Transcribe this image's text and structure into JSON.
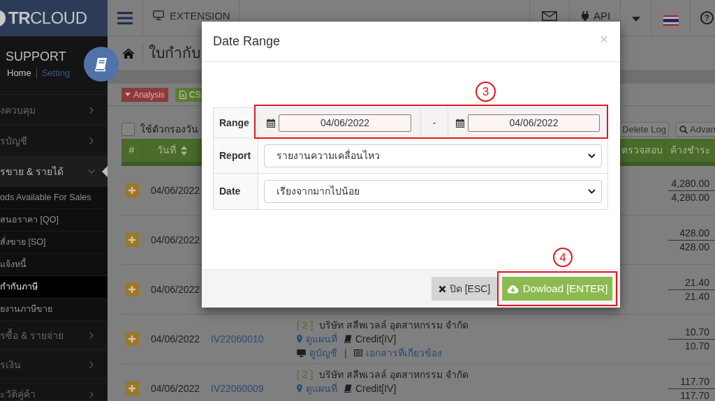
{
  "sidebar": {
    "logo": "**TR**CLOUD",
    "profile": {
      "name": "SUPPORT",
      "links": [
        {
          "kind": "current",
          "label": "Home"
        },
        {
          "kind": "link",
          "label": "Setting"
        }
      ]
    },
    "menu": [
      {
        "label": "งควบคุม",
        "expanded": false
      },
      {
        "label": "รบัญชี",
        "expanded": false
      },
      {
        "label": "รขาย & รายได้",
        "expanded": true,
        "children": [
          {
            "label": "ods Available For Sales",
            "selected": false
          },
          {
            "label": "สนอราคา [QO]",
            "selected": false
          },
          {
            "label": "สั่งขาย [SO]",
            "selected": false
          },
          {
            "label": "แจ้งหนี้",
            "selected": false
          },
          {
            "label": "กำกับภาษี",
            "selected": true
          },
          {
            "label": "ยงานภาษีขาย",
            "selected": false
          }
        ]
      },
      {
        "label": "รซื้อ & รายจ่าย",
        "expanded": false
      },
      {
        "label": "รเงิน",
        "expanded": false
      },
      {
        "label": "ะวัติคู่ค้า",
        "expanded": false
      }
    ]
  },
  "topbar": {
    "extension": "EXTENSION",
    "api": "API",
    "help": "?"
  },
  "page": {
    "title": "ใบกำกับ",
    "toolbar": [
      {
        "kind": "analysis",
        "label": "Analysis"
      },
      {
        "kind": "csv",
        "label": "CS"
      }
    ],
    "date_filter": {
      "label": "ใช้ตัวกรองวัน",
      "checked": false
    },
    "actions": [
      {
        "kind": "delete",
        "label": "Delete Log"
      },
      {
        "kind": "search",
        "label": "Advan"
      }
    ]
  },
  "table": {
    "columns": [
      {
        "kind": "index",
        "label": "#",
        "sortable": false
      },
      {
        "kind": "date",
        "label": "วันที่",
        "sortable": true
      },
      {
        "kind": "status",
        "label": "ตรวจสอบ",
        "sortable": false
      },
      {
        "kind": "balance",
        "label": "ค้างชำระ",
        "sortable": false
      }
    ],
    "rows": [
      {
        "date": "04/06/2022",
        "amounts": [
          "4,280.00",
          "4,280.00"
        ]
      },
      {
        "date": "04/06/2022",
        "amounts": [
          "428.00",
          "428.00"
        ]
      },
      {
        "date": "04/06/2022",
        "amounts": [
          "21.40",
          "21.40"
        ]
      },
      {
        "date": "04/06/2022",
        "document": "IV22060010",
        "detail": {
          "count": "[ 2 ]",
          "customer": "บริษัท สลีพเวลล์ อุตสาหกรรม จำกัด",
          "lines": [
            [
              {
                "kind": "map",
                "label": "ดูแผนที่"
              },
              {
                "kind": "credit",
                "label": "Credit[IV]"
              }
            ],
            [
              {
                "kind": "account",
                "label": "ดูบัญชี"
              },
              {
                "kind": "separator",
                "label": "|"
              },
              {
                "kind": "documents",
                "label": "เอกสารที่เกี่ยวข้อง"
              }
            ]
          ]
        },
        "amounts": [
          "10.70",
          "10.70"
        ]
      },
      {
        "date": "04/06/2022",
        "document": "IV22060009",
        "detail": {
          "count": "[ 2 ]",
          "customer": "บริษัท สลีพเวลล์ อุตสาหกรรม จำกัด",
          "lines": [
            [
              {
                "kind": "map",
                "label": "ดูแผนที่"
              },
              {
                "kind": "credit",
                "label": "Credit[IV]"
              }
            ]
          ]
        },
        "amounts": [
          "117.70",
          "117.70"
        ]
      }
    ]
  },
  "modal": {
    "title": "Date Range",
    "close": "×",
    "fields": [
      {
        "kind": "range",
        "label": "Range",
        "from": "04/06/2022",
        "separator": "-",
        "to": "04/06/2022",
        "annotation": "3"
      },
      {
        "kind": "select",
        "label": "Report",
        "value": "รายงานความเคลื่อนไหว"
      },
      {
        "kind": "select",
        "label": "Date",
        "value": "เรียงจากมากไปน้อย"
      }
    ],
    "buttons": [
      {
        "kind": "cancel",
        "label": "ปิด [ESC]"
      },
      {
        "kind": "download",
        "label": "Dowload [ENTER]",
        "annotation": "4"
      }
    ]
  }
}
